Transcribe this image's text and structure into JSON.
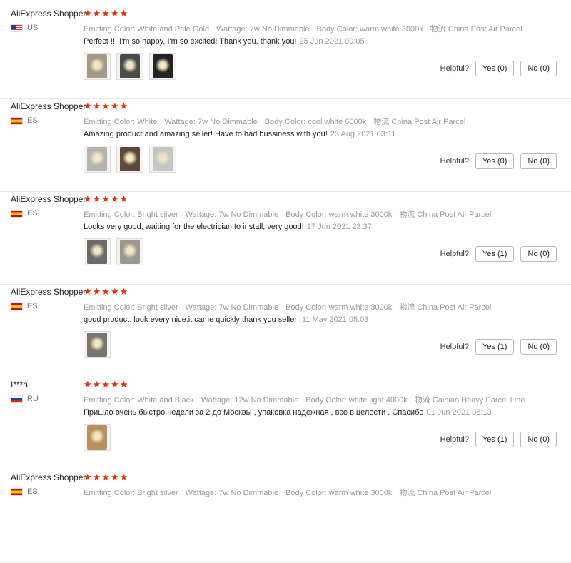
{
  "reviews": [
    {
      "user": "AliExpress Shopper",
      "country": "US",
      "flag": "us",
      "stars": "★★★★★",
      "attrs": [
        {
          "k": "Emitting Color:",
          "v": "White and Pale Gold"
        },
        {
          "k": "Wattage:",
          "v": "7w No Dimmable"
        },
        {
          "k": "Body Color:",
          "v": "warm white 3000k"
        },
        {
          "k": "物流",
          "v": "China Post Air Parcel"
        }
      ],
      "text": "Perfect !!! I'm so happy, I'm so excited! Thank you, thank you!",
      "date": "25 Jun 2021 00:05",
      "thumbs": [
        "#a59a87",
        "#4b4a47",
        "#262422"
      ],
      "helpful": "Helpful?",
      "yes": "Yes (0)",
      "no": "No (0)"
    },
    {
      "user": "AliExpress Shopper",
      "country": "ES",
      "flag": "es",
      "stars": "★★★★★",
      "attrs": [
        {
          "k": "Emitting Color:",
          "v": "White"
        },
        {
          "k": "Wattage:",
          "v": "7w No Dimmable"
        },
        {
          "k": "Body Color:",
          "v": "cool white 6000k"
        },
        {
          "k": "物流",
          "v": "China Post Air Parcel"
        }
      ],
      "text": "Amazing product and amazing seller! Have to had bussiness with you!",
      "date": "23 Aug 2021 03:11",
      "thumbs": [
        "#b8b4ad",
        "#5c4a3a",
        "#c8c6c3"
      ],
      "helpful": "Helpful?",
      "yes": "Yes (0)",
      "no": "No (0)"
    },
    {
      "user": "AliExpress Shopper",
      "country": "ES",
      "flag": "es",
      "stars": "★★★★★",
      "attrs": [
        {
          "k": "Emitting Color:",
          "v": "Bright silver"
        },
        {
          "k": "Wattage:",
          "v": "7w No Dimmable"
        },
        {
          "k": "Body Color:",
          "v": "warm white 3000k"
        },
        {
          "k": "物流",
          "v": "China Post Air Parcel"
        }
      ],
      "text": "Looks very good, waiting for the electrician to install, very good!",
      "date": "17 Jun 2021 23:37",
      "thumbs": [
        "#6d6a66",
        "#9c9890"
      ],
      "helpful": "Helpful?",
      "yes": "Yes (1)",
      "no": "No (0)"
    },
    {
      "user": "AliExpress Shopper",
      "country": "ES",
      "flag": "es",
      "stars": "★★★★★",
      "attrs": [
        {
          "k": "Emitting Color:",
          "v": "Bright silver"
        },
        {
          "k": "Wattage:",
          "v": "7w No Dimmable"
        },
        {
          "k": "Body Color:",
          "v": "warm white 3000k"
        },
        {
          "k": "物流",
          "v": "China Post Air Parcel"
        }
      ],
      "text": "good product. look every nice.it came quickly thank you seller!",
      "date": "11 May 2021 05:03",
      "thumbs": [
        "#7a766c"
      ],
      "helpful": "Helpful?",
      "yes": "Yes (1)",
      "no": "No (0)"
    },
    {
      "user": "I***a",
      "country": "RU",
      "flag": "ru",
      "stars": "★★★★★",
      "attrs": [
        {
          "k": "Emitting Color:",
          "v": "White and Black"
        },
        {
          "k": "Wattage:",
          "v": "12w No Dimmable"
        },
        {
          "k": "Body Color:",
          "v": "white light 4000k"
        },
        {
          "k": "物流",
          "v": "Cainiao Heavy Parcel Line"
        }
      ],
      "text": "Пришло очень быстро недели за 2 до Москвы , упаковка надежная , все в целости . Спасибо",
      "date": "01 Jun 2021 08:13",
      "thumbs": [
        "#b89060"
      ],
      "helpful": "Helpful?",
      "yes": "Yes (1)",
      "no": "No (0)"
    },
    {
      "user": "AliExpress Shopper",
      "country": "ES",
      "flag": "es",
      "stars": "★★★★★",
      "attrs": [
        {
          "k": "Emitting Color:",
          "v": "Bright silver"
        },
        {
          "k": "Wattage:",
          "v": "7w No Dimmable"
        },
        {
          "k": "Body Color:",
          "v": "warm white 3000k"
        },
        {
          "k": "物流",
          "v": "China Post Air Parcel"
        }
      ],
      "text": "",
      "date": "",
      "thumbs": [],
      "helpful": "",
      "yes": "",
      "no": ""
    }
  ]
}
